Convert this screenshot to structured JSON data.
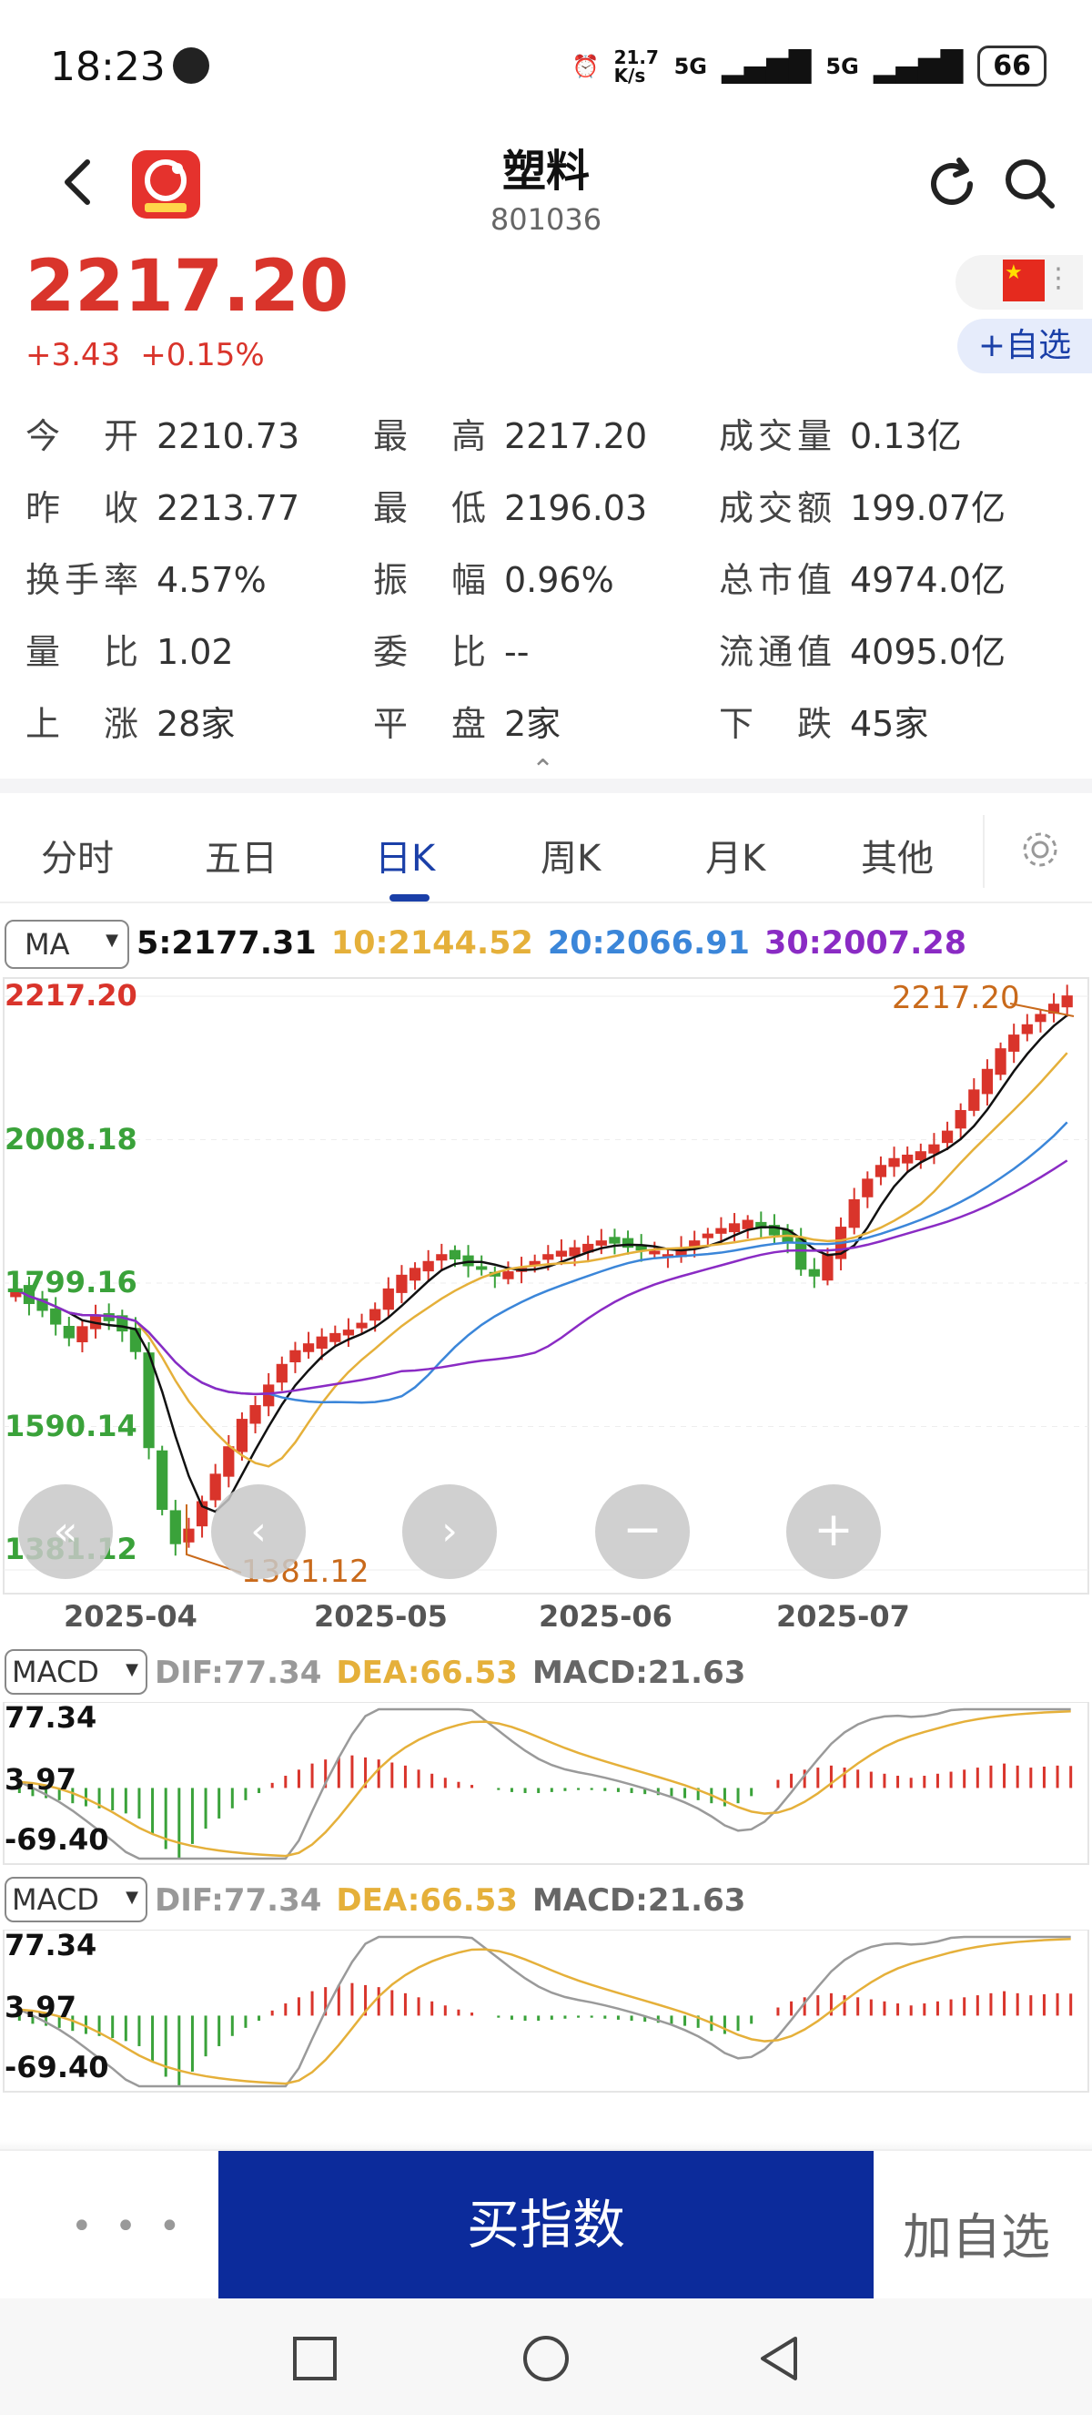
{
  "status": {
    "time": "18:23",
    "speed": "21.7 K/s",
    "net1": "5G",
    "net2": "5G",
    "battery": "66"
  },
  "header": {
    "title": "塑料",
    "code": "801036"
  },
  "quote": {
    "price": "2217.20",
    "change": "+3.43",
    "change_pct": "+0.15%",
    "add_label": "+自选"
  },
  "stats": [
    [
      {
        "label": "今开",
        "value": "2210.73"
      },
      {
        "label": "最高",
        "value": "2217.20"
      },
      {
        "label": "成交量",
        "value": "0.13亿"
      }
    ],
    [
      {
        "label": "昨收",
        "value": "2213.77"
      },
      {
        "label": "最低",
        "value": "2196.03"
      },
      {
        "label": "成交额",
        "value": "199.07亿"
      }
    ],
    [
      {
        "label": "换手率",
        "value": "4.57%"
      },
      {
        "label": "振幅",
        "value": "0.96%"
      },
      {
        "label": "总市值",
        "value": "4974.0亿"
      }
    ],
    [
      {
        "label": "量比",
        "value": "1.02"
      },
      {
        "label": "委比",
        "value": "--"
      },
      {
        "label": "流通值",
        "value": "4095.0亿"
      }
    ],
    [
      {
        "label": "上涨",
        "value": "28家"
      },
      {
        "label": "平盘",
        "value": "2家"
      },
      {
        "label": "下跌",
        "value": "45家"
      }
    ]
  ],
  "tabs": [
    "分时",
    "五日",
    "日K",
    "周K",
    "月K",
    "其他"
  ],
  "active_tab": "日K",
  "ma": {
    "selector": "MA",
    "ma5": "5:2177.31",
    "ma10": "10:2144.52",
    "ma20": "20:2066.91",
    "ma30": "30:2007.28"
  },
  "macd": {
    "selector": "MACD",
    "dif": "DIF:77.34",
    "dea": "DEA:66.53",
    "macd": "MACD:21.63",
    "ticks": [
      "77.34",
      "3.97",
      "-69.40"
    ]
  },
  "bottom": {
    "buy": "买指数",
    "add": "加自选",
    "more": "• • •"
  },
  "colors": {
    "up": "#d9342b",
    "down": "#3aa23a",
    "ma5": "#111111",
    "ma10": "#e5b03a",
    "ma20": "#3b86d9",
    "ma30": "#8a2bc4",
    "brand": "#0c2b9b"
  },
  "chart_data": [
    {
      "type": "candlestick",
      "title": "",
      "y_ticks": [
        "2217.20",
        "2008.18",
        "1799.16",
        "1590.14",
        "1381.12"
      ],
      "ylim": [
        1381.12,
        2217.2
      ],
      "x_ticks": [
        "2025-04",
        "2025-05",
        "2025-06",
        "2025-07"
      ],
      "annotations": {
        "high": "2217.20",
        "low": "1381.12"
      },
      "series_close": [
        1790,
        1770,
        1760,
        1740,
        1720,
        1735,
        1750,
        1745,
        1730,
        1700,
        1560,
        1470,
        1420,
        1440,
        1480,
        1520,
        1560,
        1600,
        1620,
        1650,
        1680,
        1700,
        1710,
        1720,
        1725,
        1730,
        1740,
        1760,
        1790,
        1810,
        1820,
        1830,
        1840,
        1835,
        1825,
        1820,
        1810,
        1815,
        1820,
        1830,
        1840,
        1845,
        1850,
        1855,
        1860,
        1858,
        1852,
        1848,
        1845,
        1840,
        1850,
        1860,
        1870,
        1878,
        1885,
        1890,
        1880,
        1870,
        1860,
        1820,
        1810,
        1840,
        1880,
        1920,
        1950,
        1970,
        1980,
        1985,
        1990,
        2000,
        2020,
        2050,
        2080,
        2110,
        2140,
        2160,
        2175,
        2190,
        2205,
        2217
      ],
      "ma5": "5:2177.31",
      "ma10": "10:2144.52",
      "ma20": "20:2066.91",
      "ma30": "30:2007.28"
    },
    {
      "type": "bar",
      "title": "MACD",
      "ylim": [
        -69.4,
        77.34
      ],
      "y_ticks": [
        "77.34",
        "3.97",
        "-69.40"
      ],
      "values": [
        -5,
        -8,
        -10,
        -12,
        -15,
        -18,
        -20,
        -22,
        -25,
        -30,
        -45,
        -60,
        -69,
        -55,
        -40,
        -30,
        -20,
        -12,
        -5,
        5,
        12,
        18,
        24,
        28,
        30,
        32,
        30,
        28,
        25,
        22,
        18,
        14,
        10,
        6,
        3,
        0,
        -2,
        -4,
        -5,
        -5,
        -4,
        -3,
        -2,
        -2,
        -3,
        -4,
        -5,
        -6,
        -7,
        -8,
        -10,
        -12,
        -15,
        -18,
        -15,
        -8,
        0,
        8,
        14,
        18,
        20,
        22,
        20,
        18,
        16,
        14,
        12,
        10,
        12,
        14,
        16,
        18,
        20,
        22,
        24,
        22,
        20,
        21,
        22,
        21.63
      ]
    }
  ]
}
